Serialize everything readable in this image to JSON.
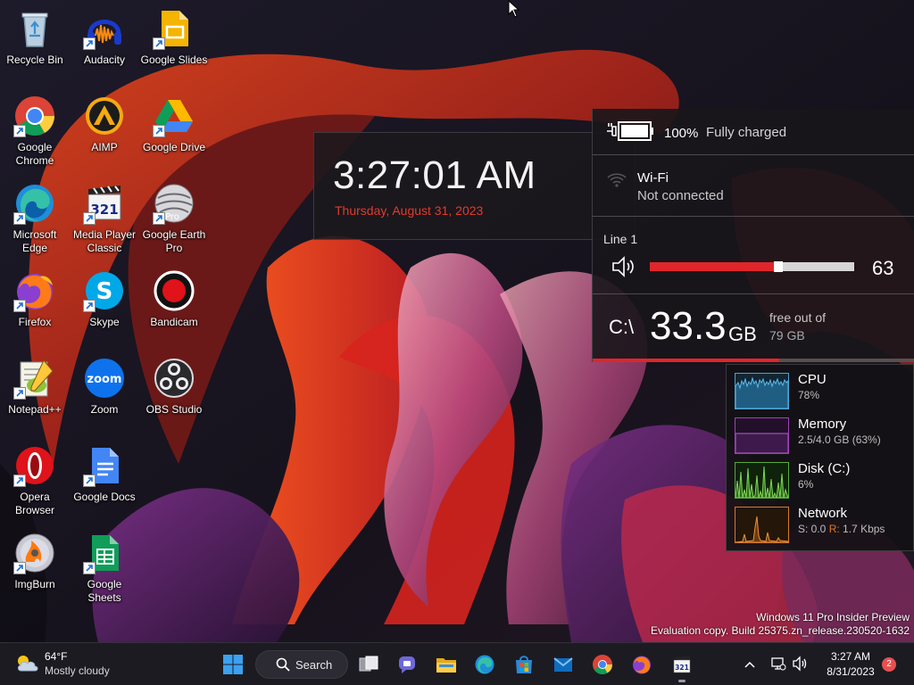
{
  "desktop": {
    "icons": [
      {
        "label": "Recycle Bin",
        "icon": "recycle-bin-icon"
      },
      {
        "label": "Google Chrome",
        "icon": "chrome-icon"
      },
      {
        "label": "Microsoft Edge",
        "icon": "edge-icon"
      },
      {
        "label": "Firefox",
        "icon": "firefox-icon"
      },
      {
        "label": "Notepad++",
        "icon": "notepadpp-icon"
      },
      {
        "label": "Opera Browser",
        "icon": "opera-icon"
      },
      {
        "label": "ImgBurn",
        "icon": "imgburn-icon"
      },
      {
        "label": "Audacity",
        "icon": "audacity-icon"
      },
      {
        "label": "AIMP",
        "icon": "aimp-icon"
      },
      {
        "label": "Media Player Classic",
        "icon": "mpc-icon"
      },
      {
        "label": "Skype",
        "icon": "skype-icon"
      },
      {
        "label": "Zoom",
        "icon": "zoom-icon"
      },
      {
        "label": "Google Docs",
        "icon": "google-docs-icon"
      },
      {
        "label": "Google Sheets",
        "icon": "google-sheets-icon"
      },
      {
        "label": "Google Slides",
        "icon": "google-slides-icon"
      },
      {
        "label": "Google Drive",
        "icon": "google-drive-icon"
      },
      {
        "label": "Google Earth Pro",
        "icon": "google-earth-icon",
        "badge": "Pro"
      },
      {
        "label": "Bandicam",
        "icon": "bandicam-icon"
      },
      {
        "label": "OBS Studio",
        "icon": "obs-icon"
      }
    ]
  },
  "clock_widget": {
    "time": "3:27:01 AM",
    "date": "Thursday, August 31, 2023",
    "date_color": "#e23b2c"
  },
  "system_panel": {
    "battery": {
      "percent_text": "100%",
      "status": "Fully charged",
      "level": 1.0
    },
    "wifi": {
      "name": "Wi-Fi",
      "status": "Not connected"
    },
    "audio": {
      "device": "Line 1",
      "volume": 63,
      "volume_text": "63",
      "accent": "#e0262a"
    },
    "drive": {
      "label": "C:\\",
      "free": "33.3",
      "unit": "GB",
      "caption": "free out of",
      "total": "79 GB",
      "free_gb": 33.3,
      "total_gb": 79
    }
  },
  "performance": {
    "cpu": {
      "name": "CPU",
      "value": "78%",
      "color": "#4aa3d6",
      "level": 0.78
    },
    "memory": {
      "name": "Memory",
      "value": "2.5/4.0 GB (63%)",
      "color": "#a33fbf",
      "level": 0.63
    },
    "disk": {
      "name": "Disk (C:)",
      "value": "6%",
      "color": "#5aa83a",
      "level": 0.06
    },
    "network": {
      "name": "Network",
      "send_label": "S: 0.0",
      "recv_label": "R:",
      "recv_value": "1.7 Kbps",
      "color": "#d57a2a"
    }
  },
  "watermark": {
    "line1": "Windows 11 Pro Insider Preview",
    "line2": "Evaluation copy. Build 25375.zn_release.230520-1632"
  },
  "taskbar": {
    "weather": {
      "temp": "64°F",
      "condition": "Mostly cloudy"
    },
    "search_label": "Search",
    "pinned": [
      "start-icon",
      "task-view-icon",
      "chat-icon",
      "file-explorer-icon",
      "edge-icon",
      "store-icon",
      "mail-icon",
      "chrome-icon",
      "firefox-icon",
      "mpc-icon"
    ],
    "clock": {
      "time": "3:27 AM",
      "date": "8/31/2023"
    },
    "notifications": "2"
  }
}
